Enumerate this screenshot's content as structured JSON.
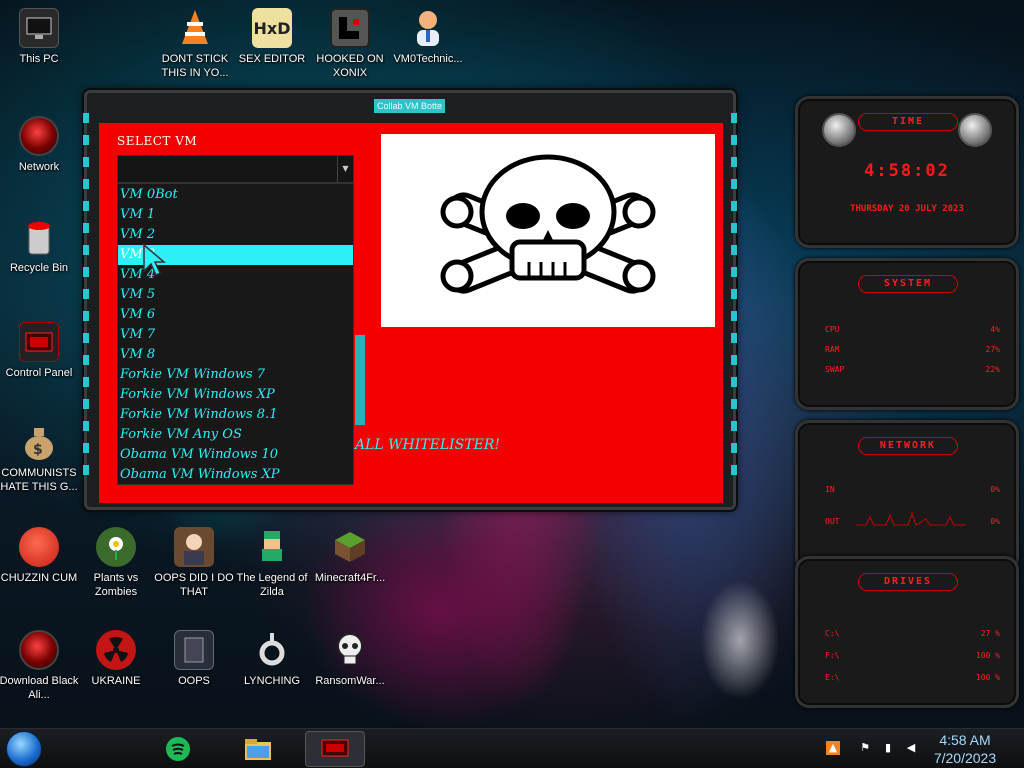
{
  "desktop": {
    "icons": [
      {
        "label": "This PC",
        "icon": "monitor-icon"
      },
      {
        "label": "DONT STICK THIS IN YO...",
        "icon": "vlc-cone-icon"
      },
      {
        "label": "SEX EDITOR",
        "icon": "hxd-editor-icon"
      },
      {
        "label": "HOOKED ON XONIX",
        "icon": "xonix-game-icon"
      },
      {
        "label": "VM0Technic...",
        "icon": "doctor-avatar-icon"
      },
      {
        "label": "Network",
        "icon": "alienware-orb-icon"
      },
      {
        "label": "Recycle Bin",
        "icon": "recycle-bin-icon"
      },
      {
        "label": "Control Panel",
        "icon": "control-panel-icon"
      },
      {
        "label": "COMMUNISTS HATE THIS G...",
        "icon": "money-bag-icon"
      },
      {
        "label": "CHUZZIN CUM",
        "icon": "chuzzle-icon"
      },
      {
        "label": "Plants vs Zombies",
        "icon": "plant-icon"
      },
      {
        "label": "OOPS DID I DO THAT",
        "icon": "portrait-icon"
      },
      {
        "label": "The Legend of Zilda",
        "icon": "pixel-hero-icon"
      },
      {
        "label": "Minecraft4Fr...",
        "icon": "grass-block-icon"
      },
      {
        "label": "Download Black Ali...",
        "icon": "alienware-orb-icon"
      },
      {
        "label": "UKRAINE",
        "icon": "radiation-icon"
      },
      {
        "label": "OOPS",
        "icon": "book-icon"
      },
      {
        "label": "LYNCHING",
        "icon": "rope-icon"
      },
      {
        "label": "RansomWar...",
        "icon": "skull-icon"
      }
    ]
  },
  "app_window": {
    "title": "Collab VM Botte",
    "select_label": "SELECT VM",
    "selected_value": "",
    "vm_options": [
      "VM 0Bot",
      "VM 1",
      "VM 2",
      "VM 3",
      "VM 4",
      "VM 5",
      "VM 6",
      "VM 7",
      "VM 8",
      "Forkie VM Windows 7",
      "Forkie VM Windows XP",
      "Forkie VM Windows 8.1",
      "Forkie VM Any OS",
      "Obama VM Windows 10",
      "Obama VM Windows XP"
    ],
    "highlighted_index": 3,
    "partial_text": "ALL WHITELISTER!",
    "preview_icon": "skull-crossbones-icon"
  },
  "widgets": {
    "time": {
      "title": "TIME",
      "clock": "4:58:02",
      "date": "THURSDAY 20 JULY 2023"
    },
    "system": {
      "title": "SYSTEM",
      "rows": [
        {
          "label": "CPU",
          "value": "4%"
        },
        {
          "label": "RAM",
          "value": "27%"
        },
        {
          "label": "SWAP",
          "value": "22%"
        }
      ]
    },
    "network": {
      "title": "NETWORK",
      "rows": [
        {
          "label": "IN",
          "value": "0%"
        },
        {
          "label": "OUT",
          "value": "0%"
        }
      ]
    },
    "drives": {
      "title": "DRIVES",
      "rows": [
        {
          "label": "C:\\",
          "value": "27 %"
        },
        {
          "label": "F:\\",
          "value": "100 %"
        },
        {
          "label": "E:\\",
          "value": "100 %"
        }
      ]
    }
  },
  "taskbar": {
    "apps": [
      "spotify-icon",
      "file-explorer-icon",
      "collab-vm-app-icon"
    ],
    "time": "4:58 AM",
    "date": "7/20/2023",
    "tray_icons": [
      "network-icon",
      "flag-icon",
      "volume-icon"
    ]
  },
  "colors": {
    "accent_cyan": "#2ef0f5",
    "window_red": "#f40000",
    "widget_red": "#ff2020"
  }
}
